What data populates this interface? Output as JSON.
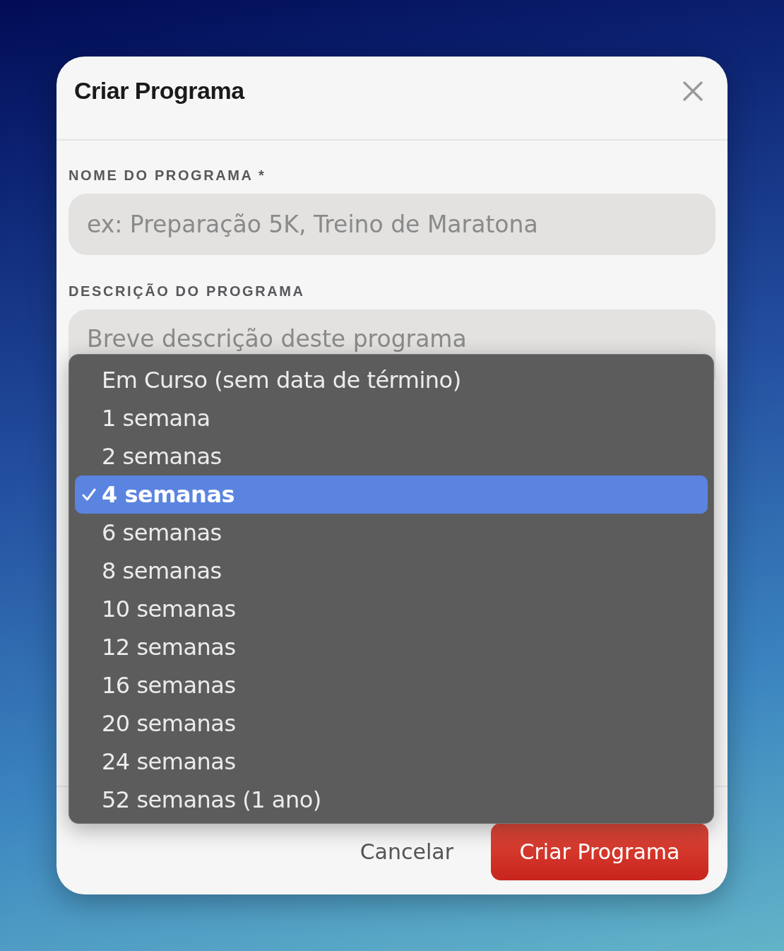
{
  "dialog": {
    "title": "Criar Programa",
    "fields": [
      {
        "label": "NOME DO PROGRAMA *",
        "placeholder": "ex: Preparação 5K, Treino de Maratona"
      },
      {
        "label": "DESCRIÇÃO DO PROGRAMA",
        "placeholder": "Breve descrição deste programa"
      }
    ],
    "duration_menu": [
      {
        "label": "Em Curso (sem data de término)",
        "selected": false
      },
      {
        "label": "1 semana",
        "selected": false
      },
      {
        "label": "2 semanas",
        "selected": false
      },
      {
        "label": "4 semanas",
        "selected": true
      },
      {
        "label": "6 semanas",
        "selected": false
      },
      {
        "label": "8 semanas",
        "selected": false
      },
      {
        "label": "10 semanas",
        "selected": false
      },
      {
        "label": "12 semanas",
        "selected": false
      },
      {
        "label": "16 semanas",
        "selected": false
      },
      {
        "label": "20 semanas",
        "selected": false
      },
      {
        "label": "24 semanas",
        "selected": false
      },
      {
        "label": "52 semanas (1 ano)",
        "selected": false
      }
    ],
    "buttons": [
      {
        "kind": "secondary",
        "label": "Cancelar"
      },
      {
        "kind": "primary",
        "label": "Criar Programa"
      }
    ]
  }
}
